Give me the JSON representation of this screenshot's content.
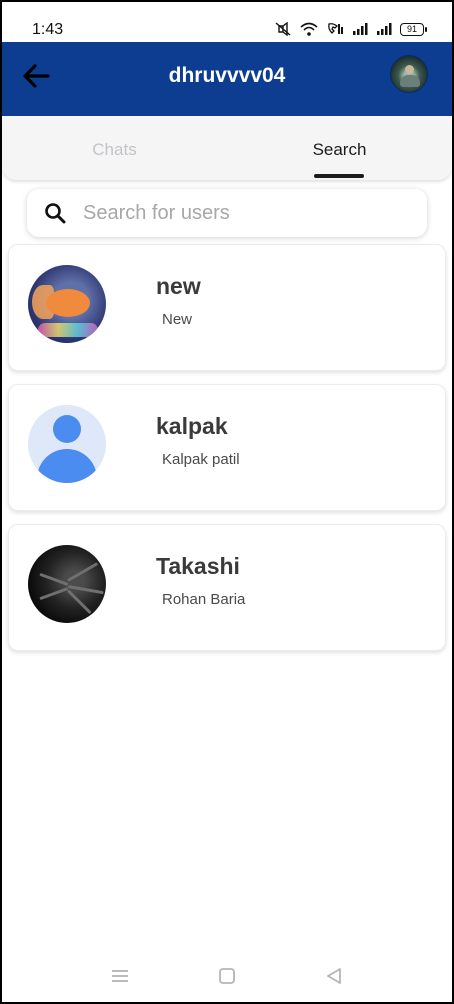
{
  "status_bar": {
    "time": "1:43",
    "battery": "91",
    "icons": [
      "mute-icon",
      "wifi-icon",
      "volte-icon",
      "signal-icon",
      "signal-icon",
      "battery-icon"
    ]
  },
  "app_bar": {
    "title": "dhruvvvv04",
    "back_icon": "arrow-left-icon",
    "accent_color": "#0d3d91"
  },
  "tabs": [
    {
      "label": "Chats",
      "active": false
    },
    {
      "label": "Search",
      "active": true
    }
  ],
  "search": {
    "placeholder": "Search for users",
    "value": ""
  },
  "users": [
    {
      "name": "new",
      "subtitle": "New",
      "avatar": "goldfish-photo"
    },
    {
      "name": "kalpak",
      "subtitle": "Kalpak patil",
      "avatar": "default-person-icon"
    },
    {
      "name": "Takashi",
      "subtitle": "Rohan Baria",
      "avatar": "dark-spider-photo"
    }
  ],
  "nav_bar": {
    "icons": [
      "menu-icon",
      "home-square-icon",
      "back-triangle-icon"
    ]
  }
}
